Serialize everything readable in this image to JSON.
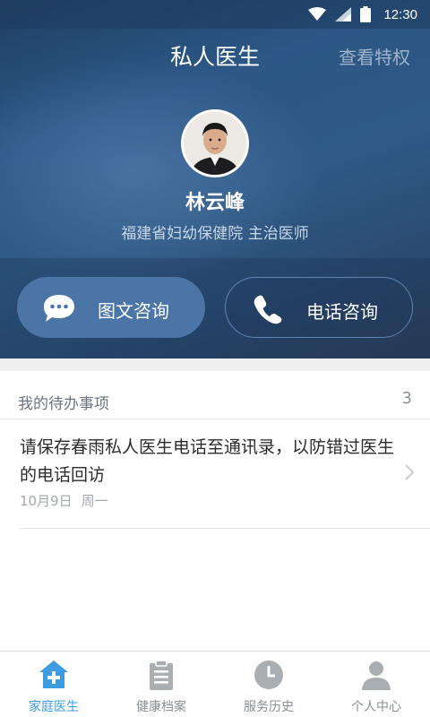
{
  "status_bar": {
    "time": "12:30"
  },
  "header": {
    "title": "私人医生",
    "privilege_link": "查看特权"
  },
  "doctor": {
    "name": "林云峰",
    "organization": "福建省妇幼保健院 主治医师"
  },
  "actions": {
    "chat_label": "图文咨询",
    "phone_label": "电话咨询"
  },
  "todo": {
    "title": "我的待办事项",
    "count": "3",
    "items": [
      {
        "text": "请保存春雨私人医生电话至通讯录，以防错过医生的电话回访",
        "date": "10月9日",
        "weekday": "周一"
      }
    ]
  },
  "tabbar": {
    "tabs": [
      {
        "label": "家庭医生",
        "icon": "home-medical-icon",
        "active": true
      },
      {
        "label": "健康档案",
        "icon": "clipboard-icon",
        "active": false
      },
      {
        "label": "服务历史",
        "icon": "clock-icon",
        "active": false
      },
      {
        "label": "个人中心",
        "icon": "person-icon",
        "active": false
      }
    ]
  },
  "colors": {
    "accent": "#3d9be0",
    "hero_dark": "#1f3f63",
    "button_fill": "#4b75a6"
  }
}
